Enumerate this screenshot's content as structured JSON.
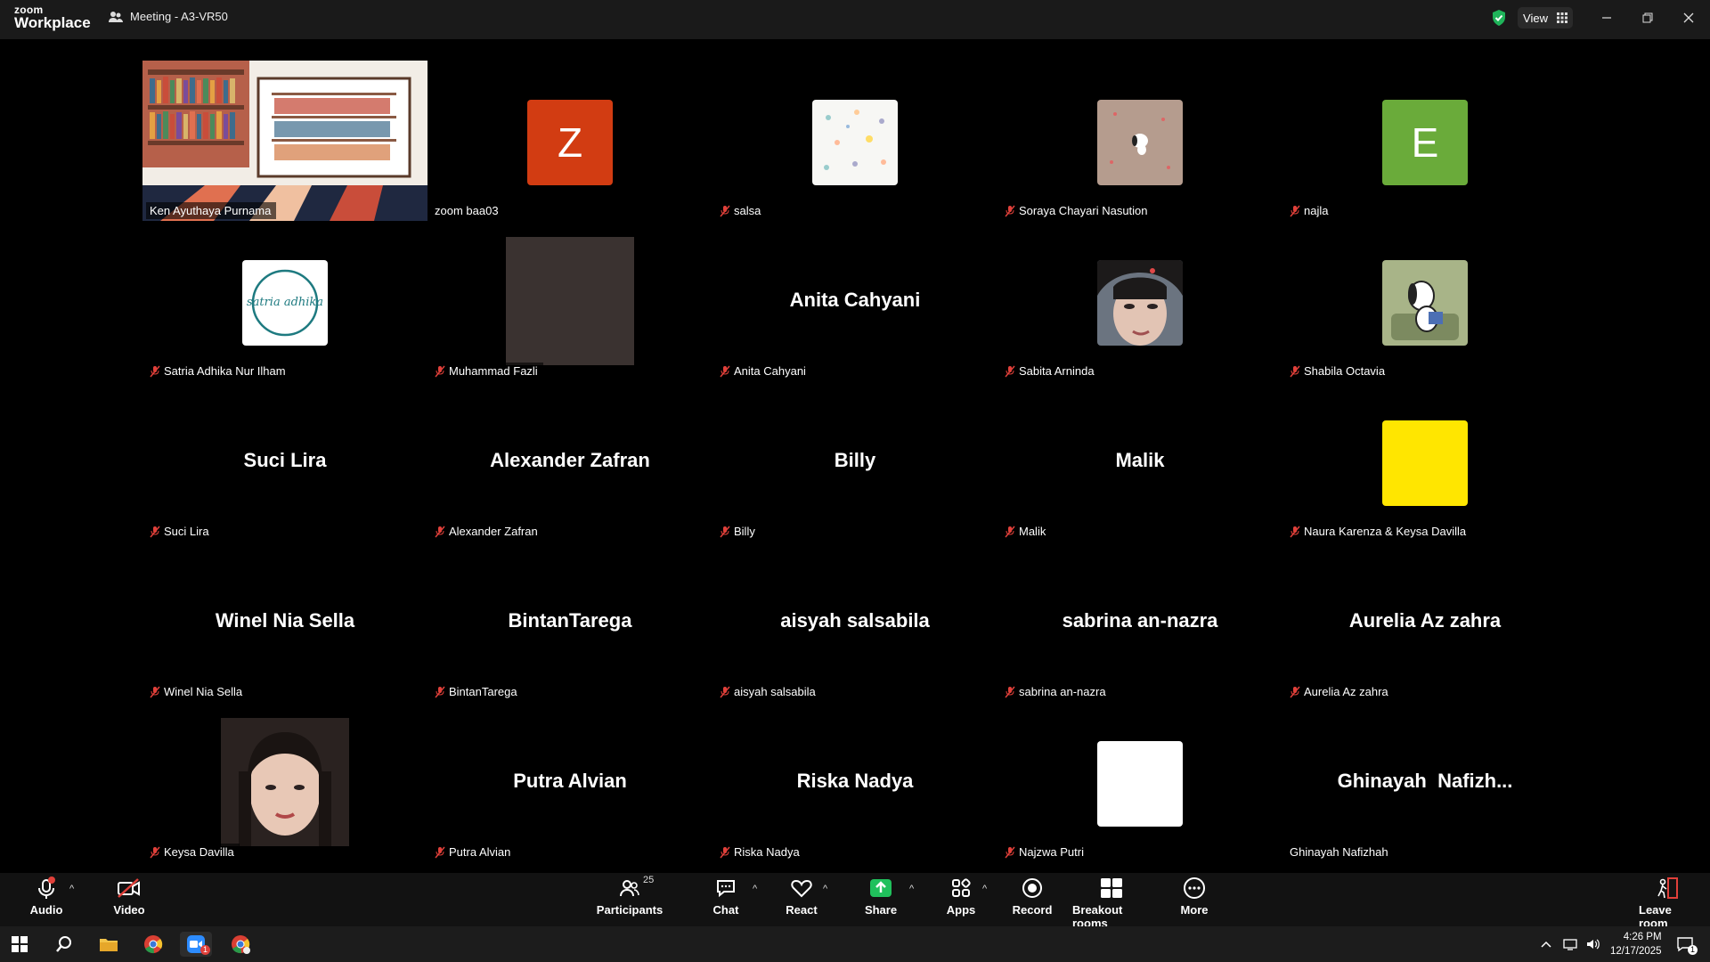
{
  "app": {
    "logo_line1": "zoom",
    "logo_line2": "Workplace",
    "meeting_title": "Meeting - A3-VR50",
    "view_label": "View"
  },
  "colors": {
    "active_border": "#2bd19a",
    "muted_icon": "#e0403a",
    "share_green": "#20c05c"
  },
  "tiles": [
    {
      "name": "Ken Ayuthaya Purnama",
      "display": "bookshelf-image",
      "muted": false,
      "active": true
    },
    {
      "name": "zoom baa03",
      "display": "letter",
      "letter": "Z",
      "avatar_color": "#d23c12",
      "muted": false
    },
    {
      "name": "salsa",
      "display": "pattern-image",
      "muted": true
    },
    {
      "name": "Soraya Chayari Nasution",
      "display": "snoopy-image",
      "muted": true
    },
    {
      "name": "najla",
      "display": "letter",
      "letter": "E",
      "avatar_color": "#6aab3a",
      "muted": true
    },
    {
      "name": "Satria Adhika Nur Ilham",
      "display": "logo-image",
      "logo_text": "satria adhika",
      "muted": true
    },
    {
      "name": "Muhammad Fazli",
      "display": "dark-video",
      "muted": true
    },
    {
      "name": "Anita Cahyani",
      "display": "name",
      "muted": true
    },
    {
      "name": "Sabita Arninda",
      "display": "photo",
      "muted": true
    },
    {
      "name": "Shabila Octavia",
      "display": "cartoon-image",
      "muted": true
    },
    {
      "name": "Suci Lira",
      "display": "name",
      "muted": true
    },
    {
      "name": "Alexander Zafran",
      "display": "name",
      "muted": true
    },
    {
      "name": "Billy",
      "display": "name",
      "muted": true
    },
    {
      "name": "Malik",
      "display": "name",
      "muted": true
    },
    {
      "name": "Naura Karenza & Keysa Davilla",
      "display": "yellow-square",
      "muted": true
    },
    {
      "name": "Winel Nia Sella",
      "display": "name",
      "muted": true
    },
    {
      "name": "BintanTarega",
      "display": "name",
      "muted": true
    },
    {
      "name": "aisyah salsabila",
      "display": "name",
      "muted": true
    },
    {
      "name": "sabrina an-nazra",
      "display": "name",
      "muted": true
    },
    {
      "name": "Aurelia Az zahra",
      "display": "name",
      "muted": true
    },
    {
      "name": "Keysa Davilla",
      "display": "portrait-video",
      "muted": true
    },
    {
      "name": "Putra Alvian",
      "display": "name",
      "muted": true
    },
    {
      "name": "Riska Nadya",
      "display": "name",
      "muted": true
    },
    {
      "name": "Najzwa Putri",
      "display": "white-square",
      "muted": true
    },
    {
      "name": "Ghinayah Nafizhah",
      "display": "name",
      "display_text": "Ghinayah  Nafizh...",
      "muted": false
    }
  ],
  "toolbar": {
    "audio": "Audio",
    "video": "Video",
    "participants": "Participants",
    "participants_count": "25",
    "chat": "Chat",
    "react": "React",
    "share": "Share",
    "apps": "Apps",
    "record": "Record",
    "breakout": "Breakout rooms",
    "more": "More",
    "leave": "Leave room"
  },
  "taskbar": {
    "time": "4:26 PM",
    "date": "12/17/2025",
    "zoom_badge": "1",
    "notification_count": "1"
  }
}
